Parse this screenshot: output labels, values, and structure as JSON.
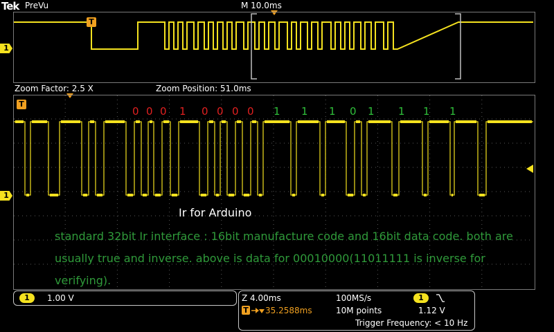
{
  "header": {
    "brand": "Tek",
    "mode": "PreVu",
    "timebase": "M 10.0ms"
  },
  "markers": {
    "channel": "1",
    "trigger": "T"
  },
  "zoom": {
    "factor_label": "Zoom Factor: 2.5 X",
    "position_label": "Zoom Position: 51.0ms"
  },
  "bits": [
    "0",
    "0",
    "0",
    "1",
    "0",
    "0",
    "0",
    "0",
    "1",
    "1",
    "1",
    "0",
    "1",
    "1",
    "1",
    "1"
  ],
  "note": {
    "title": "Ir for Arduino",
    "body": "standard 32bit Ir interface : 16bit manufacture code and 16bit data code. both are usually true and inverse. above is data for 00010000(11011111 is inverse for verifying)."
  },
  "channel_readout": {
    "label": "1",
    "scale": "1.00 V"
  },
  "acquisition": {
    "zoom_scale": "Z 4.00ms",
    "trigger_position": "35.2588ms",
    "sample_rate": "100MS/s",
    "record_length": "10M points",
    "trigger_source": "1",
    "trigger_level": "1.12 V",
    "trigger_frequency": "Trigger Frequency: < 10 Hz"
  },
  "colors": {
    "trace": "#f5e21f",
    "bit_zero": "#e02020",
    "bit_one": "#2fbf3a",
    "note_text": "#2f9a3a",
    "trigger_marker": "#f0a020"
  },
  "icons": {
    "trigger_slope": "falling-edge-icon",
    "trigger_arrow": "trigger-arrow-icon"
  }
}
